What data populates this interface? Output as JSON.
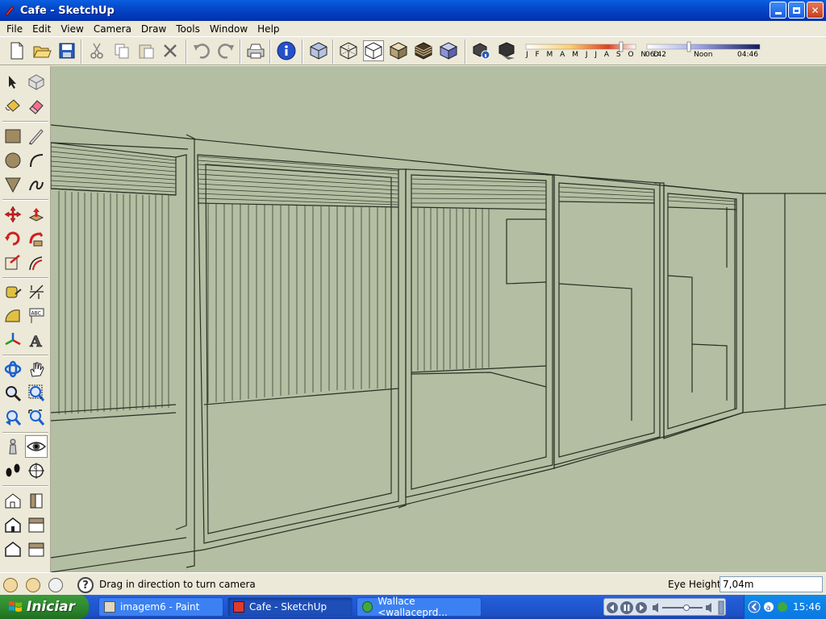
{
  "window": {
    "title": "Cafe - SketchUp"
  },
  "menu": [
    "File",
    "Edit",
    "View",
    "Camera",
    "Draw",
    "Tools",
    "Window",
    "Help"
  ],
  "shadow_settings": {
    "months": "J F M A M J J A S O N D",
    "time_start": "06:42",
    "time_mid": "Noon",
    "time_end": "04:46"
  },
  "status": {
    "message": "Drag in direction to turn camera",
    "vcb_label": "Eye Height",
    "vcb_value": "7,04m"
  },
  "taskbar": {
    "start_label": "Iniciar",
    "tasks": [
      "imagem6 - Paint",
      "Cafe - SketchUp",
      "Wallace <wallaceprd..."
    ],
    "clock": "15:46"
  },
  "colors": {
    "viewport_bg": "#b3bea2",
    "edge": "#2a2e24",
    "taskbar": "#245edb"
  }
}
